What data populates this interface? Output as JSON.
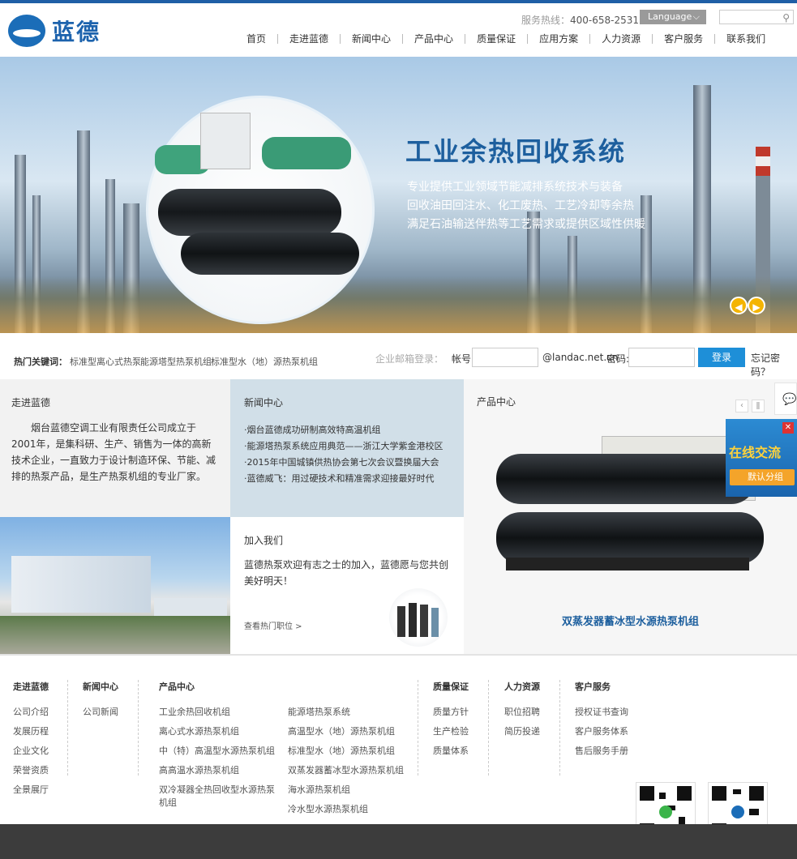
{
  "brand": {
    "name": "蓝德"
  },
  "header": {
    "hotline_label": "服务热线：",
    "hotline": "400-658-2531",
    "language": "Language",
    "search_placeholder": ""
  },
  "nav": [
    "首页",
    "走进蓝德",
    "新闻中心",
    "产品中心",
    "质量保证",
    "应用方案",
    "人力资源",
    "客户服务",
    "联系我们"
  ],
  "banner": {
    "title": "工业余热回收系统",
    "lines": [
      "专业提供工业领域节能减排系统技术与装备",
      "回收油田回注水、化工废热、工艺冷却等余热",
      "满足石油输送伴热等工艺需求或提供区域性供暖"
    ]
  },
  "keywords": {
    "label": "热门关键词：",
    "items": [
      "标准型离心式热泵",
      "能源塔型热泵机组",
      "标准型水（地）源热泵机组"
    ]
  },
  "mail_login": {
    "label": "企业邮箱登录：",
    "account_label": "帐号:",
    "domain": "@landac.net.cn",
    "password_label": "密码:",
    "login": "登录",
    "forgot": "忘记密码？"
  },
  "about": {
    "title": "走进蓝德",
    "text": "烟台蓝德空调工业有限责任公司成立于2001年，是集科研、生产、销售为一体的高新技术企业，一直致力于设计制造环保、节能、减排的热泵产品，是生产热泵机组的专业厂家。"
  },
  "news": {
    "title": "新闻中心",
    "items": [
      "·烟台蓝德成功研制高效特高温机组",
      "·能源塔热泵系统应用典范——浙江大学紫金港校区",
      "·2015年中国城镇供热协会第七次会议暨换届大会",
      "·蓝德威飞：用过硬技术和精准需求迎接最好时代"
    ]
  },
  "join": {
    "title": "加入我们",
    "text": "蓝德热泵欢迎有志之士的加入，蓝德愿与您共创美好明天！",
    "link": "查看热门职位 >"
  },
  "product": {
    "title": "产品中心",
    "caption": "双蒸发器蓄冰型水源热泵机组"
  },
  "chat": {
    "title": "在线交流",
    "group": "默认分组"
  },
  "footer": {
    "cols": [
      {
        "title": "走进蓝德",
        "links": [
          "公司介绍",
          "发展历程",
          "企业文化",
          "荣誉资质",
          "全景展厅"
        ]
      },
      {
        "title": "新闻中心",
        "links": [
          "公司新闻"
        ]
      },
      {
        "title": "产品中心",
        "links": [
          "工业余热回收机组",
          "离心式水源热泵机组",
          "中（特）高温型水源热泵机组",
          "高高温水源热泵机组",
          "双冷凝器全热回收型水源热泵机组"
        ],
        "links2": [
          "能源塔热泵系统",
          "高温型水（地）源热泵机组",
          "标准型水（地）源热泵机组",
          "双蒸发器蓄冰型水源热泵机组",
          "海水源热泵机组",
          "冷水型水源热泵机组"
        ]
      },
      {
        "title": "质量保证",
        "links": [
          "质量方针",
          "生产检验",
          "质量体系"
        ]
      },
      {
        "title": "人力资源",
        "links": [
          "职位招聘",
          "简历投递"
        ]
      },
      {
        "title": "客户服务",
        "links": [
          "授权证书查询",
          "客户服务体系",
          "售后服务手册"
        ]
      }
    ]
  },
  "colors": {
    "accent": "#1f5fa6",
    "login": "#1e8fd8",
    "chat_yellow": "#ffd23a"
  }
}
